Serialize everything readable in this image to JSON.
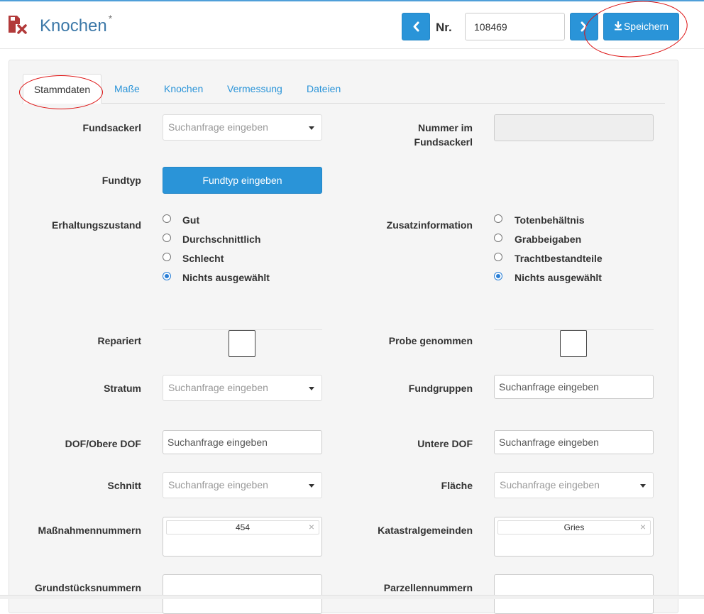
{
  "header": {
    "title": "Knochen",
    "title_marker": "*",
    "nr_label": "Nr.",
    "nr_value": "108469",
    "save_label": "Speichern"
  },
  "tabs": [
    {
      "label": "Stammdaten",
      "active": true
    },
    {
      "label": "Maße",
      "active": false
    },
    {
      "label": "Knochen",
      "active": false
    },
    {
      "label": "Vermessung",
      "active": false
    },
    {
      "label": "Dateien",
      "active": false
    }
  ],
  "form": {
    "fundsackerl": {
      "label": "Fundsackerl",
      "placeholder": "Suchanfrage eingeben"
    },
    "nummer_im_fundsackerl": {
      "label_line1": "Nummer im",
      "label_line2": "Fundsackerl",
      "value": ""
    },
    "fundtyp": {
      "label": "Fundtyp",
      "button_label": "Fundtyp eingeben"
    },
    "erhaltungszustand": {
      "label": "Erhaltungszustand",
      "options": [
        "Gut",
        "Durchschnittlich",
        "Schlecht",
        "Nichts ausgewählt"
      ],
      "selected": "Nichts ausgewählt"
    },
    "zusatzinformation": {
      "label": "Zusatzinformation",
      "options": [
        "Totenbehältnis",
        "Grabbeigaben",
        "Trachtbestandteile",
        "Nichts ausgewählt"
      ],
      "selected": "Nichts ausgewählt"
    },
    "repariert": {
      "label": "Repariert",
      "checked": false
    },
    "probe_genommen": {
      "label": "Probe genommen",
      "checked": false
    },
    "stratum": {
      "label": "Stratum",
      "placeholder": "Suchanfrage eingeben"
    },
    "fundgruppen": {
      "label": "Fundgruppen",
      "placeholder": "Suchanfrage eingeben"
    },
    "dof_obere": {
      "label": "DOF/Obere DOF",
      "placeholder": "Suchanfrage eingeben"
    },
    "untere_dof": {
      "label": "Untere DOF",
      "placeholder": "Suchanfrage eingeben"
    },
    "schnitt": {
      "label": "Schnitt",
      "placeholder": "Suchanfrage eingeben"
    },
    "flaeche": {
      "label": "Fläche",
      "placeholder": "Suchanfrage eingeben"
    },
    "massnahmennummern": {
      "label": "Maßnahmennummern",
      "tag": "454"
    },
    "katastralgemeinden": {
      "label": "Katastralgemeinden",
      "tag": "Gries"
    },
    "grundstuecksnummern": {
      "label": "Grundstücksnummern"
    },
    "parzellennummern": {
      "label": "Parzellennummern"
    }
  },
  "colors": {
    "accent": "#2a94d8",
    "title": "#3c78a8",
    "annotation": "#dd1111",
    "icon": "#b23a3a"
  },
  "icons": {
    "app": "document-delete-icon",
    "prev": "chevron-left-icon",
    "next": "chevron-right-icon",
    "save": "download-icon",
    "tag_remove": "close-icon"
  }
}
